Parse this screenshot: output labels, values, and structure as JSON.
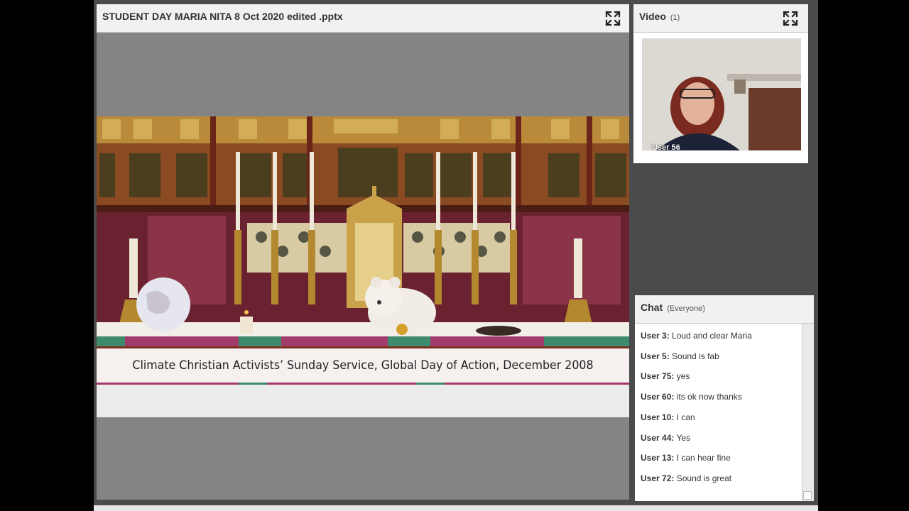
{
  "share_pod": {
    "title": "STUDENT DAY MARIA NITA 8 Oct 2020 edited .pptx",
    "slide_caption": "Climate Christian Activists’ Sunday Service, Global Day of Action, December 2008"
  },
  "video_pod": {
    "title": "Video",
    "count": "(1)",
    "user_label": "User 56"
  },
  "chat_pod": {
    "title": "Chat",
    "scope": "(Everyone)",
    "messages": [
      {
        "user": "User 3:",
        "text": "Loud and clear Maria"
      },
      {
        "user": "User 5:",
        "text": "Sound is fab"
      },
      {
        "user": "User 75:",
        "text": "yes"
      },
      {
        "user": "User 60:",
        "text": "its ok now thanks"
      },
      {
        "user": "User 10:",
        "text": "I can"
      },
      {
        "user": "User 44:",
        "text": "Yes"
      },
      {
        "user": "User 13:",
        "text": "I can hear fine"
      },
      {
        "user": "User 72:",
        "text": "Sound is great"
      }
    ]
  },
  "icons": {
    "fullscreen": "fullscreen-icon"
  },
  "colors": {
    "background": "#000000",
    "pod_background": "#4a4b4c",
    "title_bar": "#f1f1f1",
    "share_gray": "#848484"
  }
}
